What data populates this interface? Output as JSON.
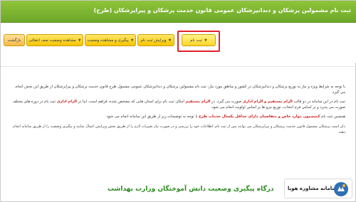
{
  "header": {
    "title": "ثبت نام مشمولین پزشکان و دندانپزشکان عمومی قانون خدمت پزشکان و پیراپزشکان (طرح)"
  },
  "tabs": [
    {
      "label": "ثبت نام",
      "active": true
    },
    {
      "label": "ویرایش ثبت نام",
      "active": false
    },
    {
      "label": "پیگیری و مشاهده وضعیت",
      "active": false
    },
    {
      "label": "مشاهده وضعیت صف انتقالی",
      "active": false
    },
    {
      "label": "بازگشت",
      "active": false
    }
  ],
  "content": {
    "para1": "با توجه به شرایط ویژه و نیاز به توزیع پزشکان و دندانپزشکان در کشور و مناطق مورد نیاز، ثبت نام مشمولین پزشکان و دندانپزشکان عمومی مشمول طرح قانون خدمت پزشکان و پیراپزشکان از طریق این بخش انجام می گیرد.",
    "para2_a": "ثبت نام در این سامانه در دو قالب",
    "para2_red1": "الزام مستقیم و الزام اداری",
    "para2_b": "صورت می گیرد. در",
    "para2_red2": "الزام مستقیم",
    "para2_c": "امکان ثبت نام برای استان هایی که مشخص شده، فراهم است. اما در",
    "para2_red3": "الزام اداری",
    "para2_d": "ثبت نام در دوره های مختلف صورت می پذیرد و بر اساس فرم انتخاب، توزیع نیرو ها بر اساس اولویت انجام می شود.",
    "para3_a": "همچنین ثبت نام",
    "para3_red": "کمیسیون موارد خاص و متقاضیان دارای حداقل یکسال خدمات طرح",
    "para3_b": "با توجه به توضیحات زیر از طریق این سامانه انجام می شود.",
    "para4": "ذکر است پزشکان مشمول قانون خدمت پزشکان و پیراپزشکان می توانند پس از ثبت نام، اطلاعات خود را بررسی و در صورت نیاز تغییرات لازم را از طریق بخش ویرایش اعمال نمایند و پیگیری وضعیت را از طریق سامانه انجام دهند."
  },
  "bottom_heading": "درگاه پیگیری وضعیت دانش آموختگان وزارت بهداشت",
  "watermark": {
    "label": "سامانه مشاوره هوپا"
  },
  "colors": {
    "header_green": "#7ab334",
    "tab_yellow": "#ffd62a",
    "highlight_red": "#e2222a",
    "heading_green": "#2b8a1e"
  }
}
